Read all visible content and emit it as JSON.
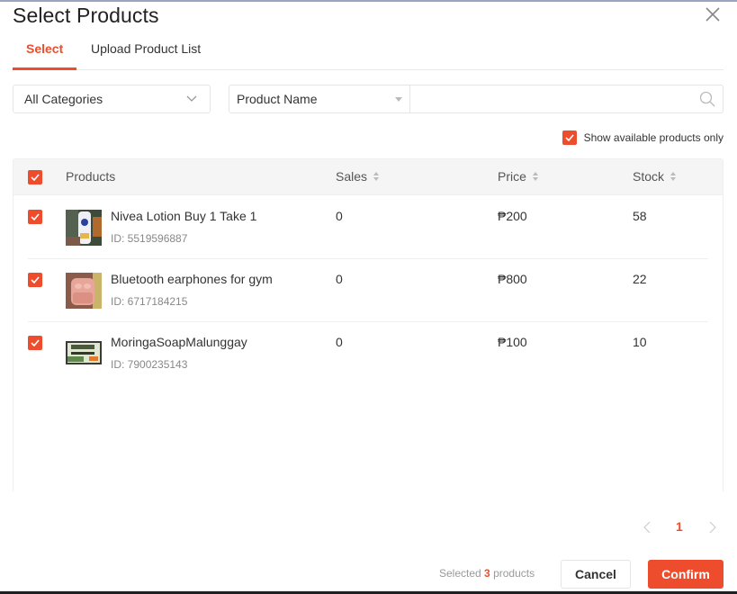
{
  "dialog": {
    "title": "Select Products",
    "close_icon": "close-icon"
  },
  "tabs": [
    {
      "label": "Select",
      "active": true
    },
    {
      "label": "Upload Product List",
      "active": false
    }
  ],
  "filters": {
    "category": {
      "selected": "All Categories",
      "icon": "chevron-down-icon"
    },
    "search_type": {
      "selected": "Product Name",
      "icon": "caret-down-icon"
    },
    "search": {
      "value": "",
      "placeholder": "",
      "icon": "search-icon"
    },
    "show_available_only": {
      "label": "Show available products only",
      "checked": true
    }
  },
  "table": {
    "select_all_checked": true,
    "columns": [
      {
        "label": "Products",
        "sortable": false
      },
      {
        "label": "Sales",
        "sortable": true
      },
      {
        "label": "Price",
        "sortable": true
      },
      {
        "label": "Stock",
        "sortable": true
      }
    ],
    "rows": [
      {
        "checked": true,
        "name": "Nivea Lotion Buy 1 Take 1",
        "id": "ID: 5519596887",
        "sales": "0",
        "price": "₱200",
        "stock": "58",
        "thumb": "lotion-bottle"
      },
      {
        "checked": true,
        "name": "Bluetooth earphones for gym",
        "id": "ID: 6717184215",
        "sales": "0",
        "price": "₱800",
        "stock": "22",
        "thumb": "pink-earbuds"
      },
      {
        "checked": true,
        "name": "MoringaSoapMalunggay",
        "id": "ID: 7900235143",
        "sales": "0",
        "price": "₱100",
        "stock": "10",
        "thumb": "soap-box"
      }
    ]
  },
  "pagination": {
    "current_page": "1",
    "prev_icon": "chevron-left-icon",
    "next_icon": "chevron-right-icon"
  },
  "footer": {
    "selected_prefix": "Selected",
    "selected_count": "3",
    "selected_suffix": "products",
    "cancel_label": "Cancel",
    "confirm_label": "Confirm"
  },
  "colors": {
    "accent": "#ee4d2d",
    "header_bg": "#f5f5f5",
    "border": "#e5e5e5"
  }
}
